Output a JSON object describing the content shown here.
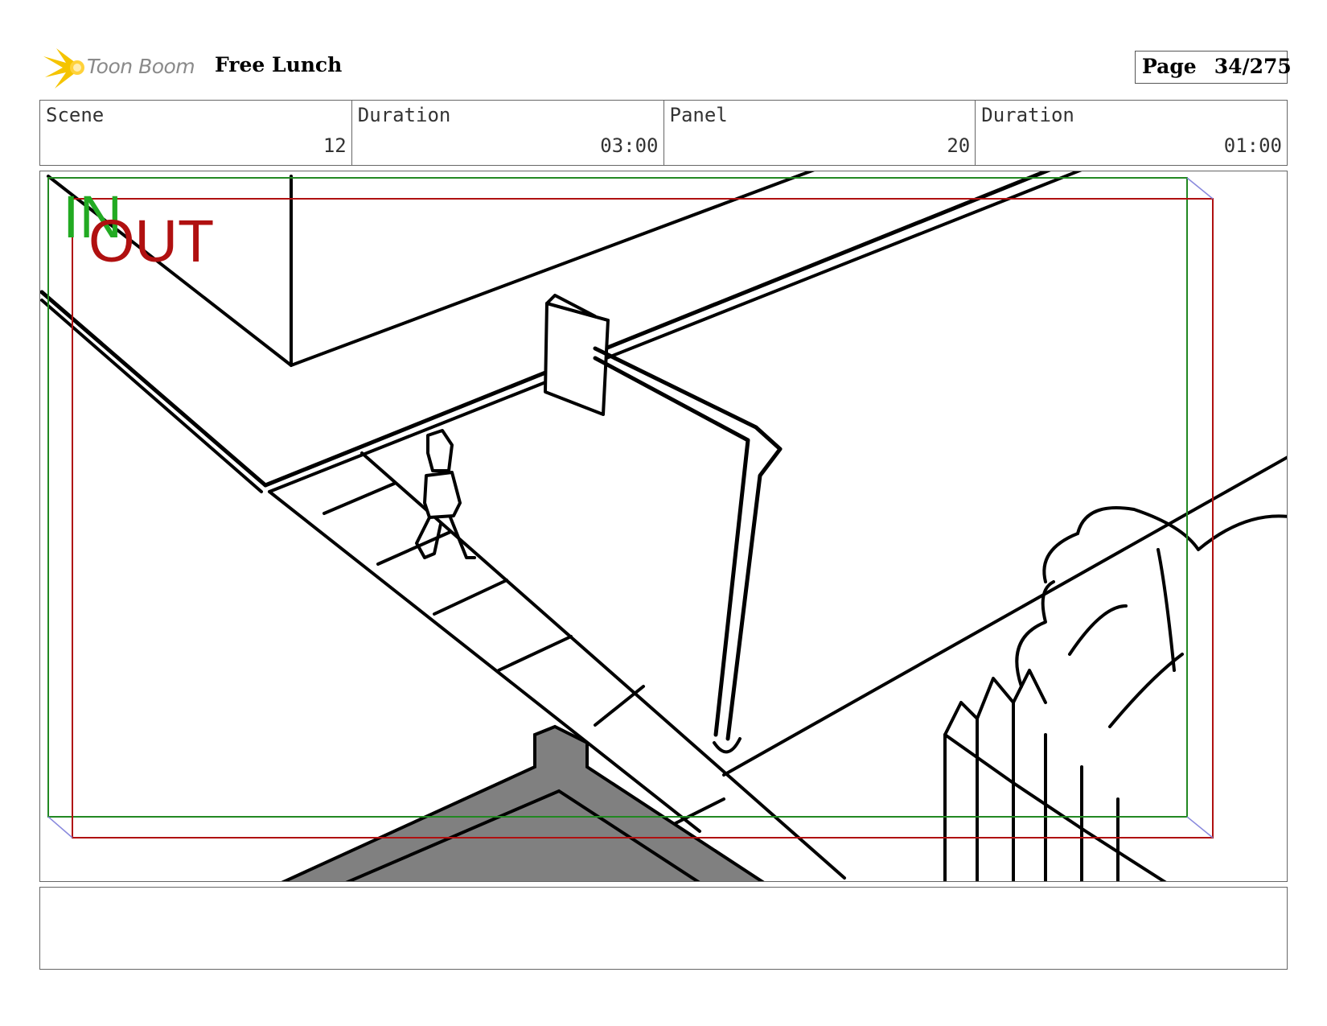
{
  "header": {
    "logo_text": "Toon Boom",
    "project_title": "Free Lunch",
    "page_label": "Page",
    "page_number": "34/275"
  },
  "info": {
    "scene_label": "Scene",
    "scene_value": "12",
    "scene_duration_label": "Duration",
    "scene_duration_value": "03:00",
    "panel_label": "Panel",
    "panel_value": "20",
    "panel_duration_label": "Duration",
    "panel_duration_value": "01:00"
  },
  "frame": {
    "in_label": "IN",
    "out_label": "OUT",
    "in_color": "#22aa22",
    "out_color": "#b01010"
  },
  "notes": {
    "text": ""
  },
  "colors": {
    "logo_star": "#f5c400",
    "roof_fill": "#808080",
    "border": "#666666"
  }
}
